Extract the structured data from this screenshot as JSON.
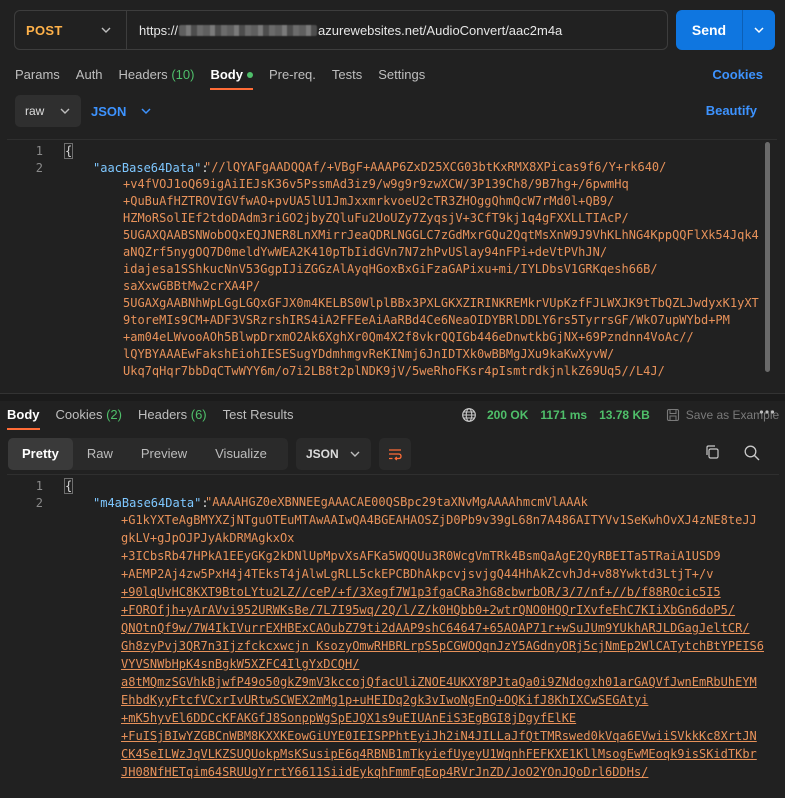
{
  "request": {
    "method": "POST",
    "url_prefix": "https://",
    "url_suffix": "azurewebsites.net/AudioConvert/aac2m4a",
    "send_label": "Send",
    "tabs": [
      {
        "label": "Params",
        "count": ""
      },
      {
        "label": "Auth",
        "count": ""
      },
      {
        "label": "Headers",
        "count": "(10)"
      },
      {
        "label": "Body",
        "count": ""
      },
      {
        "label": "Pre-req.",
        "count": ""
      },
      {
        "label": "Tests",
        "count": ""
      },
      {
        "label": "Settings",
        "count": ""
      }
    ],
    "cookies_label": "Cookies",
    "body_mode": "raw",
    "body_format": "JSON",
    "beautify_label": "Beautify",
    "line_numbers": [
      "1",
      "2"
    ],
    "open_brace": "{",
    "key": "\"aacBase64Data\"",
    "colon": ":",
    "value_lines": [
      "\"//lQYAFgAADQQAf/+VBgF+AAAP6ZxD25XCG03btKxRMX8XPicas9f6/Y+rk640/",
      "+v4fVOJ1oQ69igAiIEJsK36v5PssmAd3iz9/w9g9r9zwXCW/3P139Ch8/9B7hg+/6pwmHq",
      "+QuBuAfHZTROVIGVfwAO+pvUA5lU1JmJxxmrkvoeU2cTR3ZHOggQhmQcW7rMd0l+QB9/",
      "HZMoRSolIEf2tdoDAdm3riGO2jbyZQluFu2UoUZy7ZyqsjV+3CfT9kj1q4gFXXLLTIAcP/",
      "5UGAXQAABSNWobOQxEQJNER8LnXMirrJeaQDRLNGGLC7zGdMxrGQu2QqtMsXnW9J9VhKLhNG4KppQQFlXk54Jqk4",
      "aNQZrf5nygOQ7D0meldYwWEA2K410pTbIidGVn7N7zhPvUSlay94nFPi+deVtPVhJN/",
      "idajesa1SShkucNnV53GgpIJiZGGzAlAyqHGoxBxGiFzaGAPixu+mi/IYLDbsV1GRKqesh66B/",
      "saXxwGBBtMw2crXA4P/",
      "5UGAXgAABNhWpLGgLGQxGFJX0m4KELBS0WlplBBx3PXLGKXZIRINKREMkrVUpKzfFJLWXJK9tTbQZLJwdyxK1yXT",
      "9toreMIs9CM+ADF3VSRzrshIRS4iA2FFEeAiAaRBd4Ce6NeaOIDYBRlDDLY6rs5TyrrsGF/WkO7upWYbd+PM",
      "+am04eLWvooAOh5BlwpDrxmO2Ak6XghXr0Qm4X2f8vkrQQIGb446eDnwtkbGjNX+69Pzndnn4VoAc//",
      "lQYBYAAAEwFakshEiohIESESugYDdmhmgvReKINmj6JnIDTXk0wBBMgJXu9kaKwXyvW/",
      "Ukq7qHqr7bbDqCTwWYY6m/o7i2LB8t2plNDK9jV/5weRhoFKsr4pIsmtrdkjnlkZ69Uq5//L4J/"
    ]
  },
  "response": {
    "tabs": [
      {
        "label": "Body",
        "count": ""
      },
      {
        "label": "Cookies",
        "count": "(2)"
      },
      {
        "label": "Headers",
        "count": "(6)"
      },
      {
        "label": "Test Results",
        "count": ""
      }
    ],
    "status": "200 OK",
    "time": "1171 ms",
    "size": "13.78 KB",
    "save_example_label": "Save as Example",
    "view_tabs": [
      "Pretty",
      "Raw",
      "Preview",
      "Visualize"
    ],
    "format": "JSON",
    "line_numbers": [
      "1",
      "2"
    ],
    "open_brace": "{",
    "key": "\"m4aBase64Data\"",
    "colon": ":",
    "value_lines": [
      "\"AAAAHGZ0eXBNNEEgAAACAE00QSBpc29taXNvMgAAAAhmcmVlAAAk",
      "+G1kYXTeAgBMYXZjNTguOTEuMTAwAAIwQA4BGEAHAOSZjD0Pb9v39gL68n7A486AITYVv1SeKwhOvXJ4zNE8teJJ",
      "gkLV+gJpOJPJyAkDRMAgkxOx",
      "+3ICbsRb47HPkA1EEyGKg2kDNlUpMpvXsAFKa5WQQUu3R0WcgVmTRk4BsmQaAgE2QyRBEITa5TRaiA1USD9",
      "+AEMP2Aj4zw5PxH4j4TEksT4jAlwLgRLL5ckEPCBDhAkpcvjsvjgQ44HhAkZcvhJd+v88Ywktd3LtjT+/v",
      "+90lqUvHC8KXT9BtoLYtu2LZ//ceP/+f/3Xegf7W1p3fgaCRa3hG8cbwrbOR/3/7/nf+//b/f88ROcic5I5",
      "+FOROfjh+yArAVvi952URWKsBe/7L7I95wq/2Q/l/Z/k0HQbb0+2wtrQNO0HQQrIXvfeEhC7KIiXbGn6doP5/",
      "QNOtnQf9w/7W4IkIVurrEXHBExCAOubZ79ti2dAAP9shC64647+65AOAP71r+wSuJUm9YUkhARJLDGagJeltCR/",
      "Gh8zyPvj3QR7n3Ijzfckcxwcjn KsozyOmwRHBRLrpS5pCGWOQqnJzY5AGdnyORj5cjNmEp2WlCATytchBtYPEIS6",
      "VYVSNWbHpK4snBgkW5XZFC4IlgYxDCQH/",
      "a8tMQmzSGVhkBjwfP49o50gkZ9mV3kccojQfacUliZNOE4UKXY8PJtaQa0i9ZNdogxh01arGAQVfJwnEmRbUhEYM",
      "EhbdKyyFtcfVCxrIvURtwSCWEX2mMg1p+uHEIDq2gk3vIwoNgEnQ+OQKifJ8KhIXCwSEGAtyi",
      "+mK5hyvEl6DDCcKFAKGfJ8SonppWgSpEJQX1s9uEIUAnEiS3EgBGI8jDgyfElKE",
      "+FuISjBIwYZGBCnWBM8KXXKEowGiUYE0IEISPPhtEyiJh2iN4JILLaJfQtTMRswed0kVqa6EVwiiSVkkKc8XrtJN",
      "CK4SeILWzJqVLKZSUQUokpMsKSusipE6q4RBNB1mTkyiefUyeyU1WqnhFEFKXE1KllMsogEwMEoqk9isSKidTKbr",
      "JH08NfHETqim64SRUUgYrrtY6611SiidEykqhFmmFqEop4RVrJnZD/JoO2YOnJQoDrl6DDHs/"
    ]
  },
  "colors": {
    "method": "#ffb24a",
    "accent": "#ff6c37",
    "link": "#3d93ff",
    "send": "#0f76e0",
    "success": "#4fbf6a",
    "string": "#e8925a",
    "key": "#7ec7ff"
  },
  "icons": [
    "chevron-down-icon",
    "globe-icon",
    "save-icon",
    "more-icon",
    "wrap-icon",
    "copy-icon",
    "search-icon"
  ]
}
